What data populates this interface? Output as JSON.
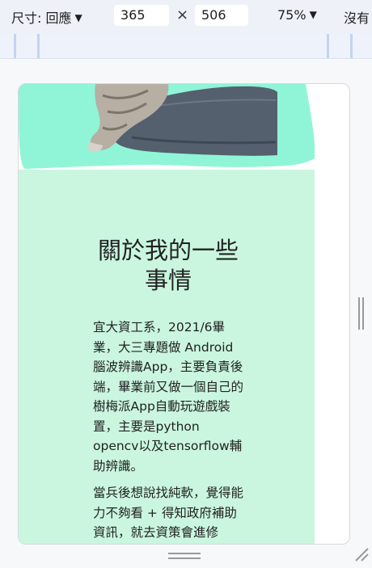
{
  "toolbar": {
    "dimensions_label": "尺寸: 回應",
    "width_value": "365",
    "times_sign": "×",
    "height_value": "506",
    "zoom_label": "75%",
    "throttle_label": "沒有"
  },
  "page": {
    "about": {
      "title": "關於我的一些事情",
      "paragraphs": [
        "宜大資工系，2021/6畢業，大三專題做 Android 腦波辨識App，主要負責後端，畢業前又做一個自己的樹梅派App自動玩遊戲裝置，主要是python opencv以及tensorflow輔助辨識。",
        "當兵後想說找純軟，覺得能力不夠看 + 得知政府補助資訊，就去資策會進修"
      ]
    }
  },
  "colors": {
    "toolbar_bg": "#eef1f8",
    "hero_mint": "#8ff5d6",
    "section_bg": "#caf6df",
    "pillow": "#55606e"
  }
}
